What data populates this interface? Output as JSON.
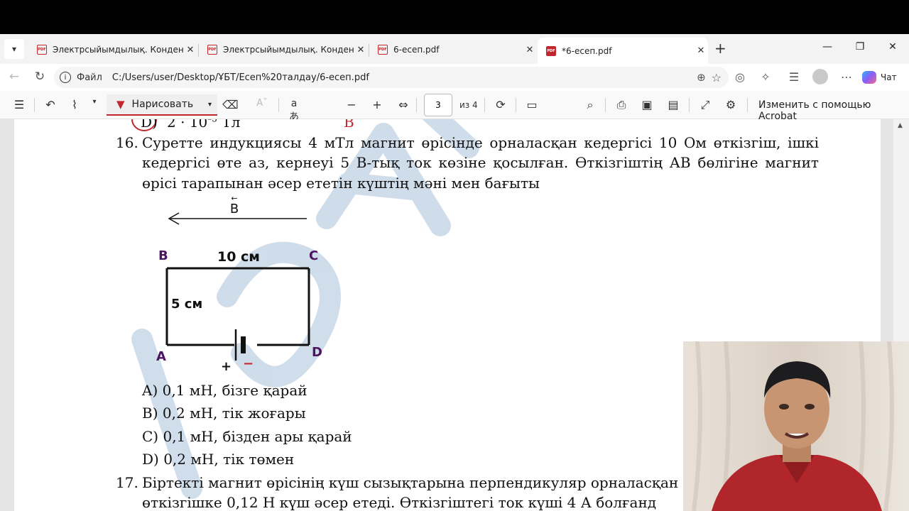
{
  "tabs": [
    {
      "title": "Электрсыйымдылық. Конденсато",
      "active": false
    },
    {
      "title": "Электрсыйымдылық. Конденсато",
      "active": false
    },
    {
      "title": "6-есеп.pdf",
      "active": false
    },
    {
      "title": "*6-есеп.pdf",
      "active": true
    }
  ],
  "address": {
    "label": "Файл",
    "url": "C:/Users/user/Desktop/ҰБТ/Есеп%20талдау/6-есеп.pdf"
  },
  "copilot_label": "Чат",
  "toolbar": {
    "draw_label": "Нарисовать",
    "page_current": "3",
    "page_total": "из 4",
    "acrobat_label": "Изменить с помощью Acrobat"
  },
  "document": {
    "prev_answer_label": "D)",
    "prev_answer_text": "2 · 10",
    "prev_answer_exp": "–5",
    "prev_answer_unit": "Тл",
    "q16_number": "16.",
    "q16_lines": [
      "Суретте индукциясы 4 мТл магнит өрісінде орналасқан кедергісі 10 Ом өткізгіш, ішкі",
      "кедергісі өте аз, кернеуі 5 В-тық ток көзіне қосылған. Өткізгіштің АВ бөлігіне магнит",
      "өрісі тарапынан әсер ететін күштің мәні мен бағыты"
    ],
    "figure": {
      "field_label": "B",
      "corner_b": "B",
      "corner_c": "C",
      "corner_a": "A",
      "corner_d": "D",
      "width_label": "10 см",
      "height_label": "5 см",
      "plus": "+",
      "minus": "−"
    },
    "answers": [
      "A) 0,1 мН, бізге қарай",
      "B) 0,2 мН, тік жоғары",
      "C) 0,1 мН, бізден ары қарай",
      "D) 0,2 мН, тік төмен"
    ],
    "q17_number": "17.",
    "q17_lines": [
      "Біртекті магнит өрісінің күш сызықтарына перпендикуляр орналасқан",
      "өткізгішке 0,12 Н күш әсер етеді. Өткізгіштегі ток күші 4 А болғанд"
    ]
  },
  "colors": {
    "accent": "#c1272d",
    "watermark": "#a9c2dc",
    "figure_labels": "#4b1560"
  }
}
